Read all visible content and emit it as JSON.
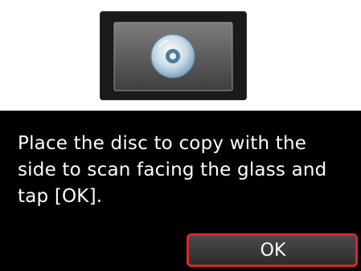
{
  "illustration": {
    "icon": "disc-icon"
  },
  "message": {
    "line1": "Place the disc to copy with the",
    "line2": "side to scan facing the glass and",
    "line3": "tap [OK]."
  },
  "actions": {
    "ok_label": "OK"
  },
  "colors": {
    "panel_background": "#000000",
    "text": "#ffffff",
    "button_border": "#d8282d",
    "button_fill": "#3a3a3a"
  }
}
